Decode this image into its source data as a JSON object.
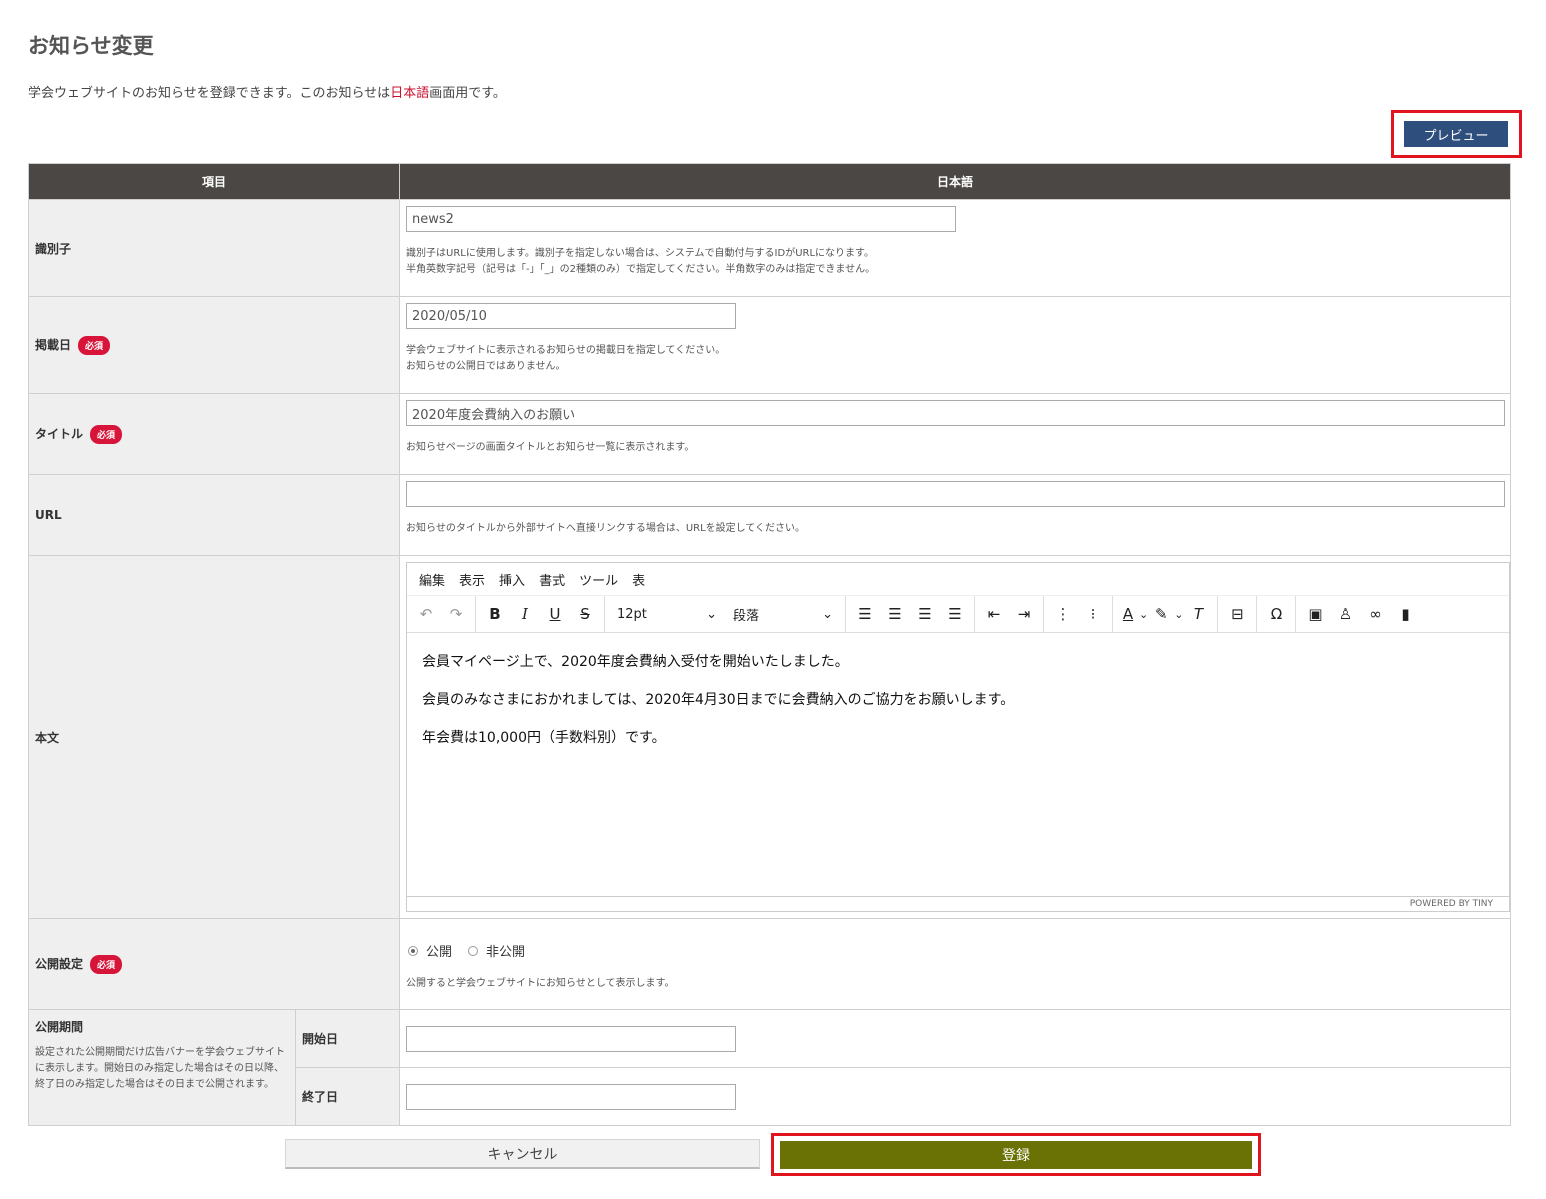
{
  "page": {
    "title": "お知らせ変更",
    "intro_before": "学会ウェブサイトのお知らせを登録できます。このお知らせは",
    "intro_highlight": "日本語",
    "intro_after": "画面用です。",
    "preview_label": "プレビュー"
  },
  "table": {
    "header_item": "項目",
    "header_lang": "日本語"
  },
  "required_badge": "必須",
  "fields": {
    "identifier": {
      "label": "識別子",
      "value": "news2",
      "help1": "識別子はURLに使用します。識別子を指定しない場合は、システムで自動付与するIDがURLになります。",
      "help2": "半角英数字記号（記号は「-」「_」の2種類のみ）で指定してください。半角数字のみは指定できません。"
    },
    "post_date": {
      "label": "掲載日",
      "value": "2020/05/10",
      "help1": "学会ウェブサイトに表示されるお知らせの掲載日を指定してください。",
      "help2": "お知らせの公開日ではありません。"
    },
    "title": {
      "label": "タイトル",
      "value": "2020年度会費納入のお願い",
      "help": "お知らせページの画面タイトルとお知らせ一覧に表示されます。"
    },
    "url": {
      "label": "URL",
      "value": "",
      "help": "お知らせのタイトルから外部サイトへ直接リンクする場合は、URLを設定してください。"
    },
    "body": {
      "label": "本文",
      "menu": [
        "編集",
        "表示",
        "挿入",
        "書式",
        "ツール",
        "表"
      ],
      "font_size": "12pt",
      "block_format": "段落",
      "paragraphs": [
        "会員マイページ上で、2020年度会費納入受付を開始いたしました。",
        "会員のみなさまにおかれましては、2020年4月30日までに会費納入のご協力をお願いします。",
        "年会費は10,000円（手数料別）です。"
      ],
      "powered_by": "POWERED BY TINY"
    },
    "publish": {
      "label": "公開設定",
      "option_public": "公開",
      "option_private": "非公開",
      "selected": "公開",
      "help": "公開すると学会ウェブサイトにお知らせとして表示します。"
    },
    "period": {
      "label": "公開期間",
      "description": "設定された公開期間だけ広告バナーを学会ウェブサイトに表示します。開始日のみ指定した場合はその日以降、終了日のみ指定した場合はその日まで公開されます。",
      "start_label": "開始日",
      "end_label": "終了日",
      "start_value": "",
      "end_value": ""
    }
  },
  "buttons": {
    "cancel": "キャンセル",
    "register": "登録"
  },
  "colors": {
    "header_bg": "#4a4745",
    "required_badge": "#d7153a",
    "preview_button": "#2e4e7e",
    "register_button": "#6b7205",
    "highlight_outline": "#e0141e"
  }
}
